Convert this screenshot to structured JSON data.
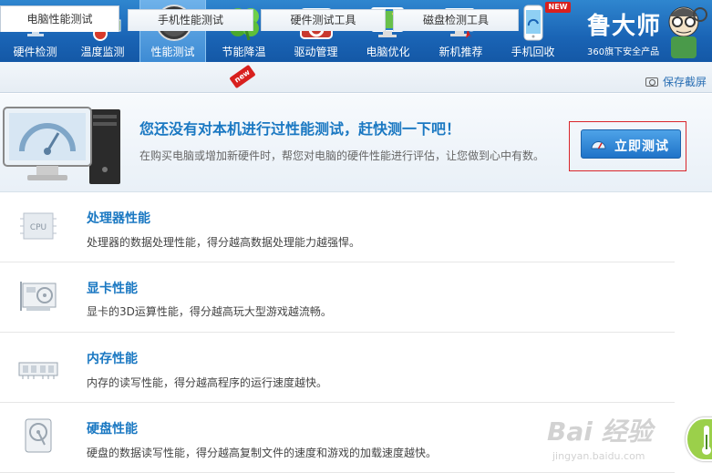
{
  "nav": {
    "items": [
      {
        "label": "硬件检测",
        "icon": "magnifier-monitor-icon"
      },
      {
        "label": "温度监测",
        "icon": "thermometer-icon"
      },
      {
        "label": "性能测试",
        "icon": "speedometer-icon",
        "active": true
      },
      {
        "label": "节能降温",
        "icon": "clover-icon"
      },
      {
        "label": "驱动管理",
        "icon": "gear-box-icon"
      },
      {
        "label": "电脑优化",
        "icon": "monitor-broom-icon"
      },
      {
        "label": "新机推荐",
        "icon": "monitor-medal-icon"
      },
      {
        "label": "手机回收",
        "icon": "phone-recycle-icon"
      }
    ],
    "new_badge": "NEW"
  },
  "brand": {
    "name": "鲁大师",
    "sub": "360旗下安全产品"
  },
  "tabs": [
    {
      "label": "电脑性能测试",
      "active": true
    },
    {
      "label": "手机性能测试"
    },
    {
      "label": "硬件测试工具"
    },
    {
      "label": "磁盘检测工具"
    }
  ],
  "tab_new_badge": "new",
  "snapshot_label": "保存截屏",
  "banner": {
    "title": "您还没有对本机进行过性能测试，赶快测一下吧！",
    "desc": "在购买电脑或增加新硬件时，帮您对电脑的硬件性能进行评估，让您做到心中有数。",
    "button_label": "立即测试"
  },
  "features": [
    {
      "title": "处理器性能",
      "desc": "处理器的数据处理性能，得分越高数据处理能力越强悍。",
      "icon": "cpu-icon"
    },
    {
      "title": "显卡性能",
      "desc": "显卡的3D运算性能，得分越高玩大型游戏越流畅。",
      "icon": "graphics-card-icon"
    },
    {
      "title": "内存性能",
      "desc": "内存的读写性能，得分越高程序的运行速度越快。",
      "icon": "memory-stick-icon"
    },
    {
      "title": "硬盘性能",
      "desc": "硬盘的数据读写性能，得分越高复制文件的速度和游戏的加载速度越快。",
      "icon": "hard-disk-icon"
    }
  ],
  "watermark": {
    "logo": "Bai 经验",
    "url": "jingyan.baidu.com"
  },
  "colors": {
    "toolbar": "#1a64b5",
    "accent": "#1a78c2",
    "highlight_frame": "#d9252a",
    "new_badge": "#d8201e"
  }
}
